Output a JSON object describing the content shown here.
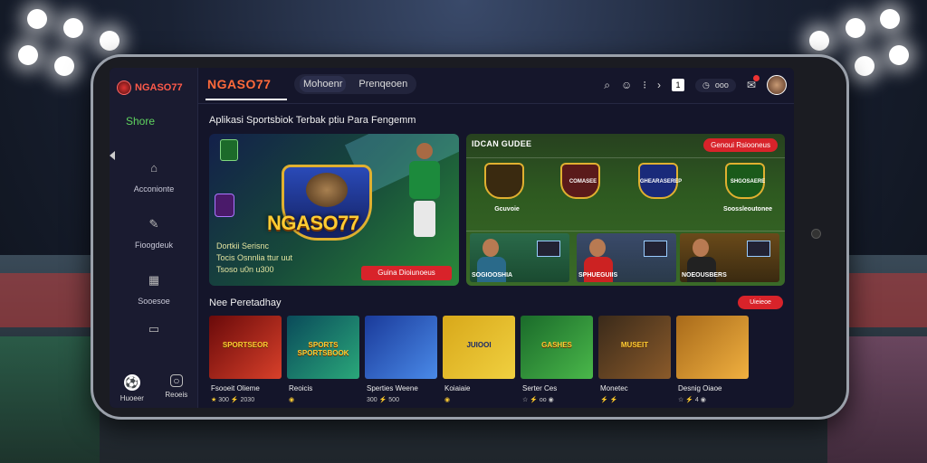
{
  "sidebar": {
    "logo_text": "NGASO77",
    "section_label": "Shore",
    "items": [
      {
        "label": "Acconionte",
        "icon": "home-icon"
      },
      {
        "label": "Fioogdeuk",
        "icon": "leaf-icon"
      },
      {
        "label": "Sooesoe",
        "icon": "grid-icon"
      },
      {
        "label": "",
        "icon": "stats-icon"
      }
    ],
    "bottom_tabs": [
      {
        "label": "Huoeer",
        "icon": "soccer-ball-icon"
      },
      {
        "label": "Reoeis",
        "icon": "profile-icon"
      }
    ]
  },
  "topbar": {
    "brand": "NGASO77",
    "tabs": [
      "Mohoenr",
      "Prenqeoen"
    ],
    "icons": [
      "search-icon",
      "emoji-icon",
      "settings-icon",
      "chevron-right-icon",
      "bookmark-icon",
      "clock-icon",
      "chat-icon",
      "avatar"
    ],
    "pill_text": "ooo",
    "square_icon_text": "1"
  },
  "main": {
    "heading": "Aplikasi Sportsbiok Terbak ptiu Para Fengemm",
    "hero": {
      "logo_title": "NGASO77",
      "sub_line1": "Dortkii Serisnc",
      "sub_line2": "Tocis Osnnlia ttur uut",
      "sub_line3": "Tsoso u0n u300",
      "button_label": "Guina Dioiunoeus"
    },
    "panel": {
      "title": "IDCAN GUDEE",
      "button_label": "Genoui Rsiooneus",
      "badges": [
        "COMASEE",
        "GHEARASEREP",
        "",
        "SHGOSAERE"
      ],
      "badge_captions": [
        "Gcuvoie",
        "",
        "",
        "Soossleoutonee"
      ],
      "matches": [
        "SOGIOOSHIA",
        "SPHUEGUIIS",
        "NOEOUSBERS"
      ]
    },
    "section2_title": "Nee Peretadhay",
    "section2_button": "Uieieoe",
    "games": [
      {
        "art_text": "SPORTSEOR",
        "name": "Fsooeit Olieme",
        "rating": "★",
        "meta": "300 ⚡ 2030"
      },
      {
        "art_text": "SPORTS SPORTSBOOK",
        "name": "Reoicis",
        "rating": "◉",
        "meta": ""
      },
      {
        "art_text": "",
        "name": "Sperties Weene",
        "rating": "",
        "meta": "300 ⚡ 500"
      },
      {
        "art_text": "JUIOOI",
        "name": "Koiaiaie",
        "rating": "◉",
        "meta": ""
      },
      {
        "art_text": "GASHES",
        "name": "Serter Ces",
        "rating": "",
        "meta": "☆ ⚡ oo ◉"
      },
      {
        "art_text": "MUSEIT",
        "name": "Monetec",
        "rating": "",
        "meta": "⚡ ⚡"
      },
      {
        "art_text": "",
        "name": "Desnig Oiaoe",
        "rating": "",
        "meta": "☆ ⚡ 4 ◉"
      }
    ]
  },
  "colors": {
    "accent_red": "#d8232a",
    "brand_orange": "#ff6a3a",
    "green_label": "#5fd35f",
    "gold": "#ffcc33"
  }
}
